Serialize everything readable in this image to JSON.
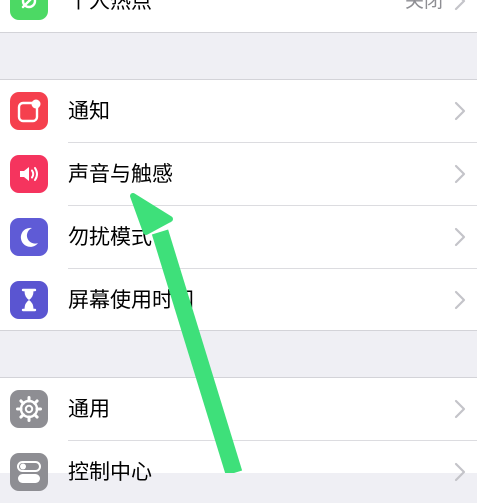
{
  "settings": {
    "group0": {
      "personal_hotspot": {
        "label": "个人热点",
        "value": "关闭",
        "icon": "personal-hotspot-icon",
        "color": "#4cd964"
      }
    },
    "group1": [
      {
        "label": "通知",
        "icon": "notifications-icon",
        "color": "#f5404e"
      },
      {
        "label": "声音与触感",
        "icon": "sounds-icon",
        "color": "#f5345e"
      },
      {
        "label": "勿扰模式",
        "icon": "moon-icon",
        "color": "#5f5bd6"
      },
      {
        "label": "屏幕使用时间",
        "icon": "hourglass-icon",
        "color": "#5a55d1"
      }
    ],
    "group2": [
      {
        "label": "通用",
        "icon": "gear-icon",
        "color": "#8e8e93"
      },
      {
        "label": "控制中心",
        "icon": "toggle-icon",
        "color": "#8e8e93"
      }
    ]
  },
  "annotation": {
    "icon": "arrow-pointer-icon",
    "color": "#3ee07a"
  }
}
